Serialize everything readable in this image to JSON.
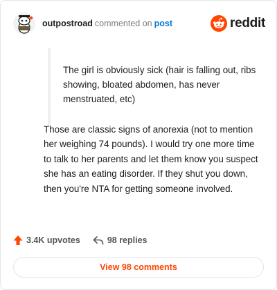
{
  "header": {
    "username": "outpostroad",
    "action": "commented on",
    "post_link": "post",
    "brand": "reddit",
    "avatar_icon": "snoo-avatar-icon",
    "brand_icon": "reddit-logo-icon",
    "brand_color": "#ff4500"
  },
  "quote": {
    "text": "The girl is obviously sick (hair is falling out, ribs showing, bloated abdomen, has never menstruated, etc)"
  },
  "comment": {
    "text": "Those are classic signs of anorexia (not to mention her weighing 74 pounds). I would try one more time to talk to her parents and let them know you suspect she has an eating disorder. If they shut you down, then you're NTA for getting someone involved."
  },
  "stats": {
    "upvotes": "3.4K upvotes",
    "replies": "98 replies",
    "upvote_icon": "upvote-arrow-icon",
    "reply_icon": "reply-arrow-icon"
  },
  "footer": {
    "view_label": "View 98 comments"
  }
}
